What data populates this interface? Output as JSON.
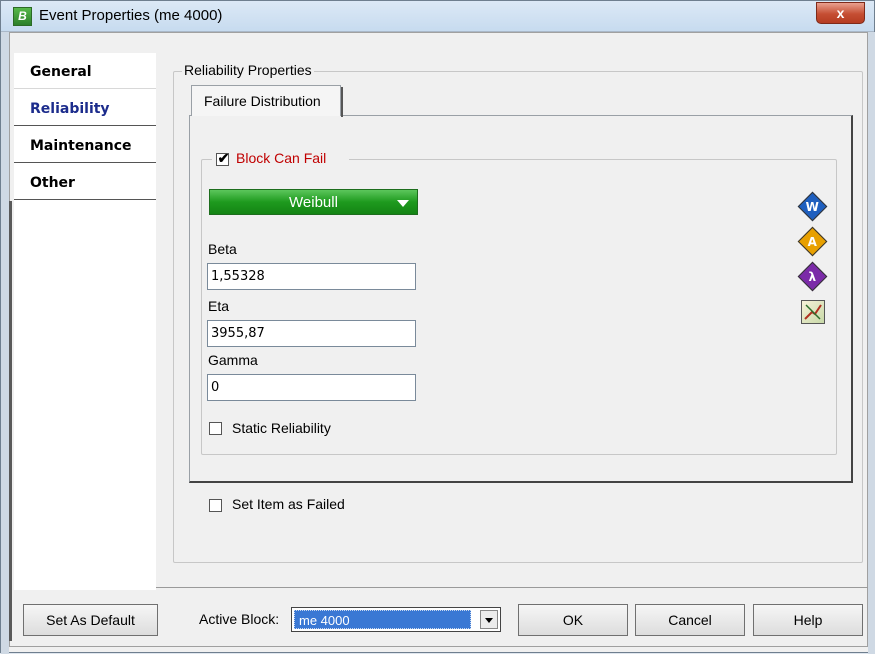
{
  "window": {
    "title": "Event Properties (me 4000)",
    "app_icon_letter": "B",
    "close_symbol": "x"
  },
  "nav": {
    "items": [
      {
        "label": "General",
        "active": false
      },
      {
        "label": "Reliability",
        "active": true
      },
      {
        "label": "Maintenance",
        "active": false
      },
      {
        "label": "Other",
        "active": false
      }
    ]
  },
  "reliability": {
    "group_title": "Reliability Properties",
    "tab_label": "Failure Distribution",
    "block_can_fail": {
      "label": "Block Can Fail",
      "checked": true
    },
    "distribution": "Weibull",
    "fields": [
      {
        "label": "Beta",
        "value": "1,55328"
      },
      {
        "label": "Eta",
        "value": "3955,87"
      },
      {
        "label": "Gamma",
        "value": "0"
      }
    ],
    "static_reliability": {
      "label": "Static Reliability",
      "checked": false
    },
    "side_buttons": [
      {
        "icon": "weibull-icon",
        "glyph": "W",
        "color": "#1e5fbf"
      },
      {
        "icon": "warning-icon",
        "glyph": "A",
        "color": "#e8a000"
      },
      {
        "icon": "lambda-icon",
        "glyph": "λ",
        "color": "#7b2aa8"
      },
      {
        "icon": "plot-icon",
        "glyph": "",
        "color": "#7aa040"
      }
    ]
  },
  "set_item_failed": {
    "label": "Set Item as Failed",
    "checked": false
  },
  "footer": {
    "set_default": "Set As Default",
    "active_block_label": "Active Block:",
    "active_block_value": "me 4000",
    "ok": "OK",
    "cancel": "Cancel",
    "help": "Help"
  },
  "colors": {
    "accent_red": "#c00000",
    "nav_active": "#1c2c8c",
    "dropdown_green": "#1e9a1e"
  }
}
